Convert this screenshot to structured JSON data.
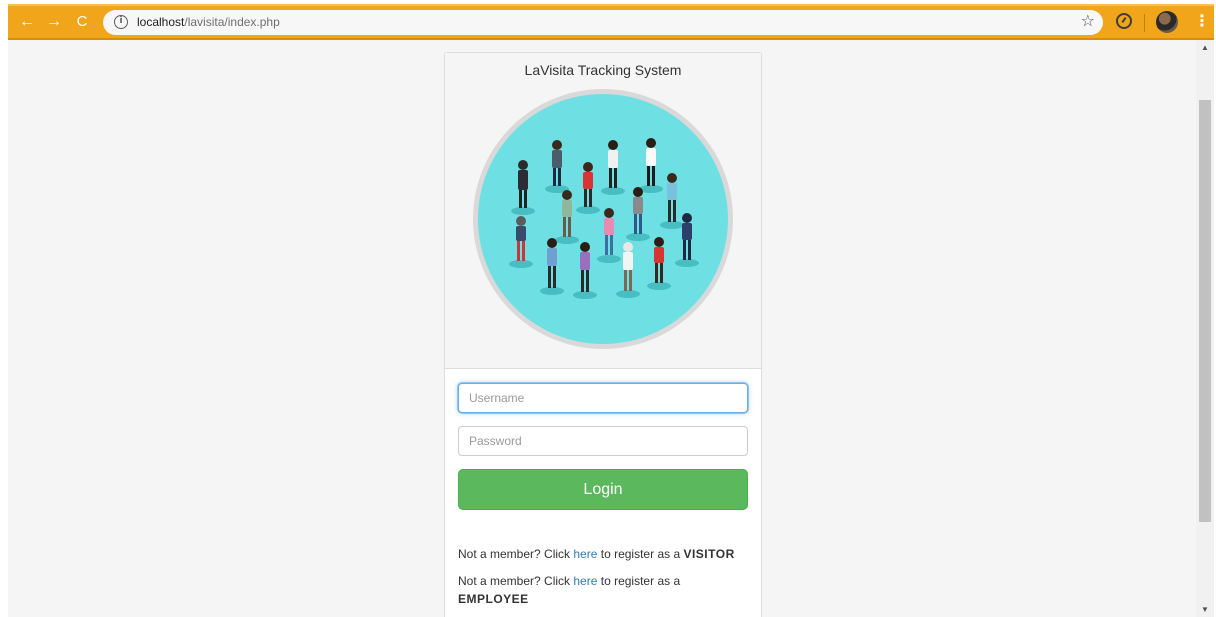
{
  "browser": {
    "url_host": "localhost",
    "url_path": "/lavisita/index.php",
    "colors": {
      "chrome": "#f1a51a",
      "omnibox": "#f7f7f7"
    }
  },
  "icons": {
    "back": "arrow-left-icon",
    "forward": "arrow-right-icon",
    "reload": "reload-icon",
    "info": "info-icon",
    "star": "star-icon",
    "extension": "speedometer-icon",
    "profile": "profile-avatar-icon",
    "menu": "kebab-menu-icon"
  },
  "card": {
    "title": "LaVisita Tracking System"
  },
  "form": {
    "username_placeholder": "Username",
    "password_placeholder": "Password",
    "login_label": "Login"
  },
  "register": {
    "visitor": {
      "prefix": "Not a member? Click",
      "link": "here",
      "mid": "to register as a",
      "role": "VISITOR"
    },
    "employee": {
      "prefix": "Not a member? Click",
      "link": "here",
      "mid": "to register as a",
      "role": "EMPLOYEE"
    }
  },
  "colors": {
    "login_button": "#5cb85c",
    "link": "#337ab7",
    "avatar_circle": "#6ee0e4",
    "focus_border": "#66afe9"
  }
}
